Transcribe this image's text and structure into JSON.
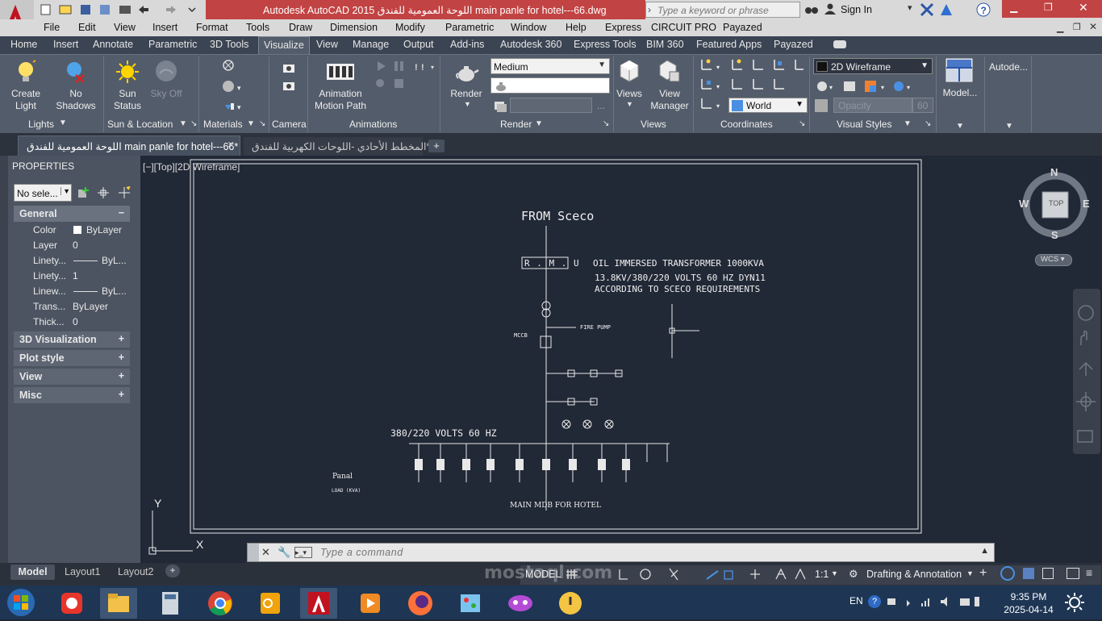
{
  "window": {
    "title": "Autodesk AutoCAD 2015  اللوحة العمومية للفندق main panle for hotel---66.dwg",
    "search_placeholder": "Type a keyword or phrase",
    "sign_in": "Sign In"
  },
  "menu": [
    "File",
    "Edit",
    "View",
    "Insert",
    "Format",
    "Tools",
    "Draw",
    "Dimension",
    "Modify",
    "Parametric",
    "Window",
    "Help",
    "Express",
    "CIRCUIT PRO",
    "Payazed"
  ],
  "ribbon_tabs": [
    "Home",
    "Insert",
    "Annotate",
    "Parametric",
    "3D Tools",
    "Visualize",
    "View",
    "Manage",
    "Output",
    "Add-ins",
    "Autodesk 360",
    "Express Tools",
    "BIM 360",
    "Featured Apps",
    "Payazed"
  ],
  "active_tab": "Visualize",
  "ribbon": {
    "lights": {
      "create_light": "Create\nLight",
      "no_shadows": "No\nShadows",
      "label": "Lights"
    },
    "sun": {
      "sun_status": "Sun\nStatus",
      "sky_off": "Sky Off",
      "label": "Sun & Location"
    },
    "materials": {
      "label": "Materials"
    },
    "camera": {
      "label": "Camera"
    },
    "animations": {
      "motion_path": "Animation\nMotion Path",
      "label": "Animations"
    },
    "render": {
      "render_btn": "Render",
      "preset": "Medium",
      "label": "Render"
    },
    "views": {
      "views_btn": "Views",
      "view_manager": "View\nManager",
      "label": "Views"
    },
    "coordinates": {
      "world": "World",
      "label": "Coordinates"
    },
    "visual_styles": {
      "style": "2D Wireframe",
      "opacity": "Opacity",
      "opacity_value": "60",
      "label": "Visual Styles"
    },
    "model": "Model...",
    "autodesk": "Autode..."
  },
  "doc_tabs": [
    {
      "label": "اللوحة العمومية للفندق main panle for hotel---66*",
      "active": true
    },
    {
      "label": "المخطط الأحادي -اللوحات الكهربية للفندق*",
      "active": false
    }
  ],
  "properties": {
    "title": "PROPERTIES",
    "selection": "No sele...",
    "general": "General",
    "rows": [
      {
        "name": "Color",
        "value": "ByLayer"
      },
      {
        "name": "Layer",
        "value": "0"
      },
      {
        "name": "Linety...",
        "value": "ByL..."
      },
      {
        "name": "Linety...",
        "value": "1"
      },
      {
        "name": "Linew...",
        "value": "ByL..."
      },
      {
        "name": "Trans...",
        "value": "ByLayer"
      },
      {
        "name": "Thick...",
        "value": "0"
      }
    ],
    "sections": [
      "3D Visualization",
      "Plot style",
      "View",
      "Misc"
    ]
  },
  "viewport": {
    "label": "[−][Top][2D Wireframe]",
    "viewcube": {
      "top": "TOP",
      "n": "N",
      "s": "S",
      "e": "E",
      "w": "W",
      "wcs": "WCS"
    }
  },
  "drawing": {
    "from": "FROM Sceco",
    "rmu": "R . M . U",
    "transformer_1": "OIL IMMERSED TRANSFORMER 1000KVA",
    "transformer_2": "13.8KV/380/220 VOLTS 60 HZ DYN11",
    "transformer_3": "ACCORDING TO SCECO REQUIREMENTS",
    "fire_pump": "FIRE PUMP",
    "mccb": "MCCB",
    "volts": "380/220 VOLTS 60 HZ",
    "panel": "Panal",
    "load": "LOAD (KVA)",
    "title": "MAIN MDB FOR HOTEL"
  },
  "command": {
    "placeholder": "Type a command"
  },
  "layout_tabs": [
    "Model",
    "Layout1",
    "Layout2"
  ],
  "status": {
    "model": "MODEL",
    "scale": "1:1",
    "workspace": "Drafting & Annotation"
  },
  "taskbar": {
    "lang": "EN",
    "time": "9:35 PM",
    "date": "2025-04-14"
  },
  "watermark": "mostaql.com"
}
